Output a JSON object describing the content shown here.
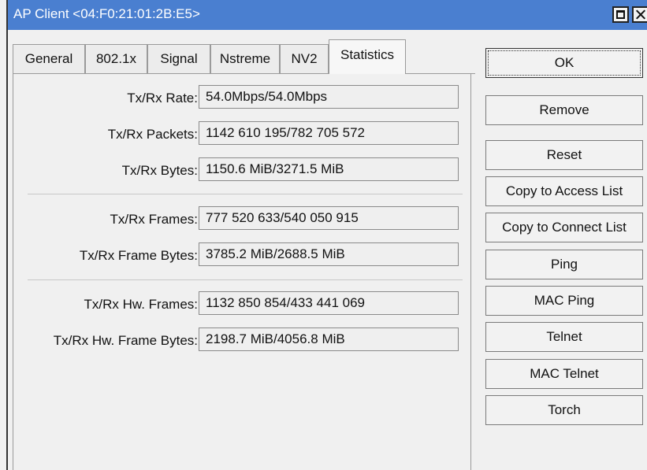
{
  "window": {
    "title": "AP Client <04:F0:21:01:2B:E5>"
  },
  "tabs": [
    {
      "label": "General",
      "active": false
    },
    {
      "label": "802.1x",
      "active": false
    },
    {
      "label": "Signal",
      "active": false
    },
    {
      "label": "Nstreme",
      "active": false
    },
    {
      "label": "NV2",
      "active": false
    },
    {
      "label": "Statistics",
      "active": true
    }
  ],
  "stats": [
    {
      "label": "Tx/Rx Rate:",
      "value": "54.0Mbps/54.0Mbps"
    },
    {
      "label": "Tx/Rx Packets:",
      "value": "1142 610 195/782 705 572"
    },
    {
      "label": "Tx/Rx Bytes:",
      "value": "1150.6 MiB/3271.5 MiB"
    },
    {
      "label": "Tx/Rx Frames:",
      "value": "777 520 633/540 050 915"
    },
    {
      "label": "Tx/Rx Frame Bytes:",
      "value": "3785.2 MiB/2688.5 MiB"
    },
    {
      "label": "Tx/Rx Hw. Frames:",
      "value": "1132 850 854/433 441 069"
    },
    {
      "label": "Tx/Rx Hw. Frame Bytes:",
      "value": "2198.7 MiB/4056.8 MiB"
    }
  ],
  "buttons": [
    {
      "label": "OK"
    },
    {
      "label": "Remove"
    },
    {
      "label": "Reset"
    },
    {
      "label": "Copy to Access List"
    },
    {
      "label": "Copy to Connect List"
    },
    {
      "label": "Ping"
    },
    {
      "label": "MAC Ping"
    },
    {
      "label": "Telnet"
    },
    {
      "label": "MAC Telnet"
    },
    {
      "label": "Torch"
    }
  ]
}
